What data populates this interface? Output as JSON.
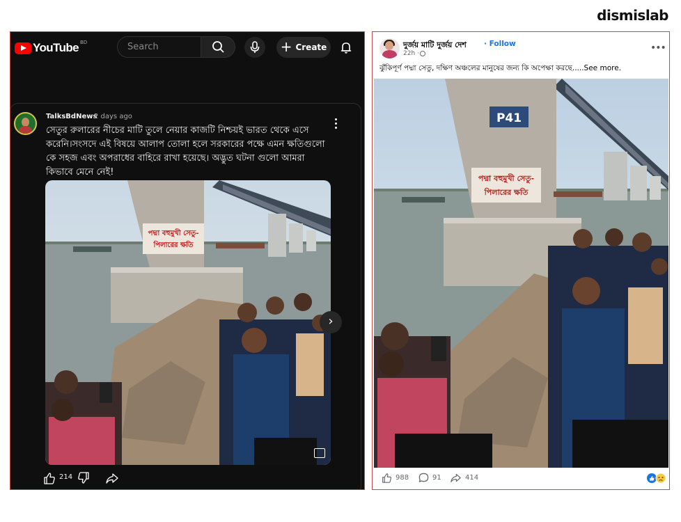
{
  "watermark": "dismislab",
  "youtube": {
    "logo_text": "YouTube",
    "country_code": "BD",
    "search_placeholder": "Search",
    "create_label": "Create",
    "post": {
      "channel": "TalksBdNews",
      "time": "2 days ago",
      "text": "সেতুর রুলারের নীচের মাটি তুলে নেয়ার কাজটি নিশ্চয়ই ভারত থেকে এসে করেনি।সংসদে এই বিষয়ে আলাপ তোলা হলে সরকারের পক্ষে এমন ক্ষতিগুলো কে সহজ এবং অপরাধের বাহিরে রাখা হয়েছে।  অদ্ভুত ঘটনা গুলো আমরা কিভাবে মেনে নেই!",
      "like_count": "214",
      "pillar_sign": "পদ্মা বহুমুখী সেতু-\nপিলারের ক্ষতি"
    }
  },
  "facebook": {
    "page_name": "দুর্জয় মাটি দুর্জয় দেশ",
    "follow_label": "· Follow",
    "time": "22h ·",
    "caption": "ঝুঁকিপূর্ণ পদ্মা সেতু, দক্ষিণ অঞ্চলের মানুষের জন্য কি অপেক্ষা করছে.....See more.",
    "pillar_label": "P41",
    "pillar_sign": "পদ্মা বহুমুখী সেতু-\nপিলারের ক্ষতি",
    "like_count": "988",
    "comment_count": "91",
    "share_count": "414"
  },
  "colors": {
    "youtube_red": "#ff0000",
    "yt_background": "#0f0f0f",
    "fb_link_blue": "#1b74e4",
    "panel_border": "#c44a4a"
  },
  "icons": [
    "youtube-logo-icon",
    "search-icon",
    "mic-icon",
    "plus-icon",
    "bell-icon",
    "more-vertical-icon",
    "chevron-right-icon",
    "gallery-icon",
    "like-icon",
    "dislike-icon",
    "share-icon",
    "globe-icon",
    "more-horizontal-icon",
    "comment-icon",
    "reaction-icons"
  ]
}
